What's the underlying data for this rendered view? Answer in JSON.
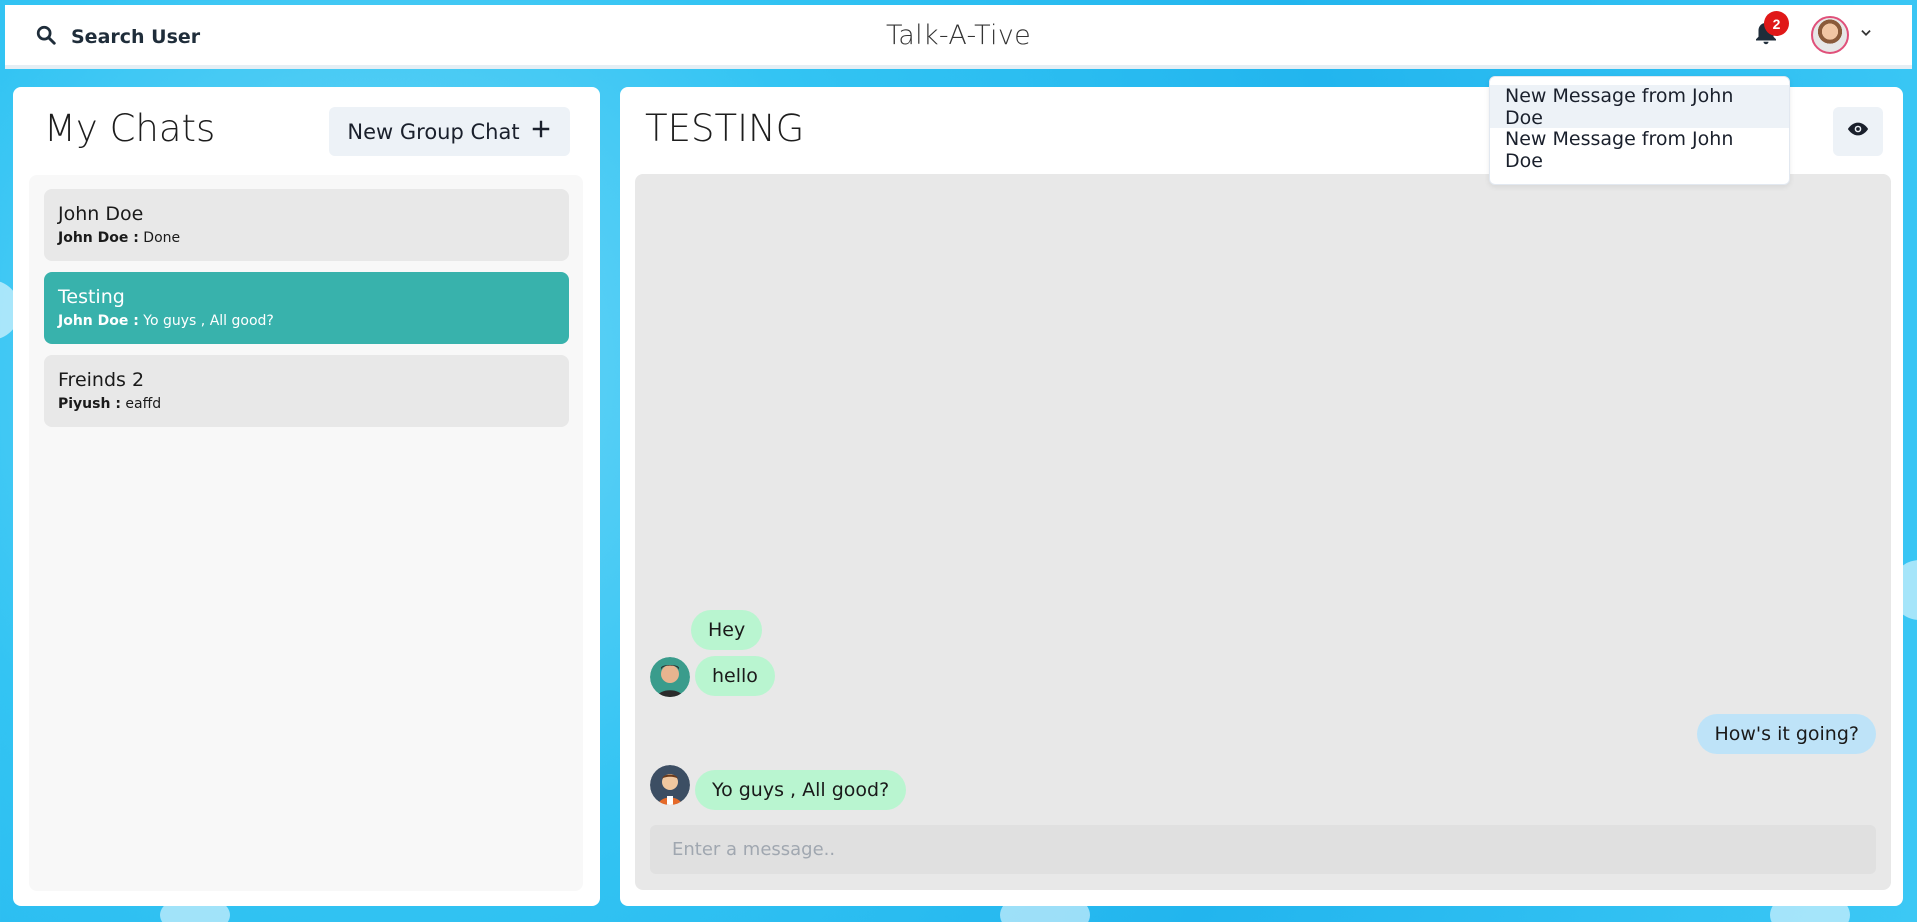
{
  "topbar": {
    "search_label": "Search User",
    "app_title": "Talk-A-Tive",
    "notification_count": "2"
  },
  "notifications": {
    "items": [
      {
        "label": "New Message from John Doe"
      },
      {
        "label": "New Message from John Doe"
      }
    ]
  },
  "sidebar": {
    "title": "My Chats",
    "new_group_label": "New Group Chat",
    "chats": [
      {
        "name": "John Doe",
        "sender": "John Doe :",
        "preview": "Done",
        "active": false
      },
      {
        "name": "Testing",
        "sender": "John Doe :",
        "preview": "Yo guys , All good?",
        "active": true
      },
      {
        "name": "Freinds 2",
        "sender": "Piyush :",
        "preview": "eaffd",
        "active": false
      }
    ]
  },
  "chat": {
    "title": "TESTING",
    "messages": [
      {
        "text": "Hey",
        "direction": "incoming"
      },
      {
        "text": "hello",
        "direction": "incoming"
      },
      {
        "text": "How's it going?",
        "direction": "outgoing"
      },
      {
        "text": "Yo guys , All good?",
        "direction": "incoming"
      }
    ],
    "input_placeholder": "Enter a message.."
  },
  "colors": {
    "accent_active_chat": "#38b2ac",
    "incoming_bubble": "#b9f5d0",
    "outgoing_bubble": "#bee3f8",
    "badge": "#e01818"
  }
}
